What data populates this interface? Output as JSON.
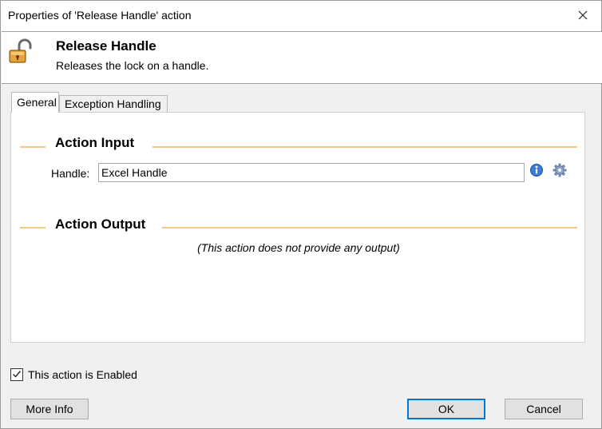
{
  "window": {
    "title": "Properties of 'Release Handle' action"
  },
  "header": {
    "title": "Release Handle",
    "description": "Releases the lock on a handle.",
    "icon": "unlocked-padlock-icon"
  },
  "tabs": [
    {
      "label": "General",
      "active": true
    },
    {
      "label": "Exception Handling",
      "active": false
    }
  ],
  "input_section": {
    "title": "Action Input",
    "fields": [
      {
        "label": "Handle:",
        "value": "Excel Handle"
      }
    ]
  },
  "output_section": {
    "title": "Action Output",
    "note": "(This action does not provide any output)"
  },
  "enabled": {
    "label": "This action is Enabled",
    "checked": true
  },
  "buttons": {
    "more_info": "More Info",
    "ok": "OK",
    "cancel": "Cancel"
  },
  "colors": {
    "section_line": "#f5c98c",
    "default_button_border": "#0078d7"
  }
}
